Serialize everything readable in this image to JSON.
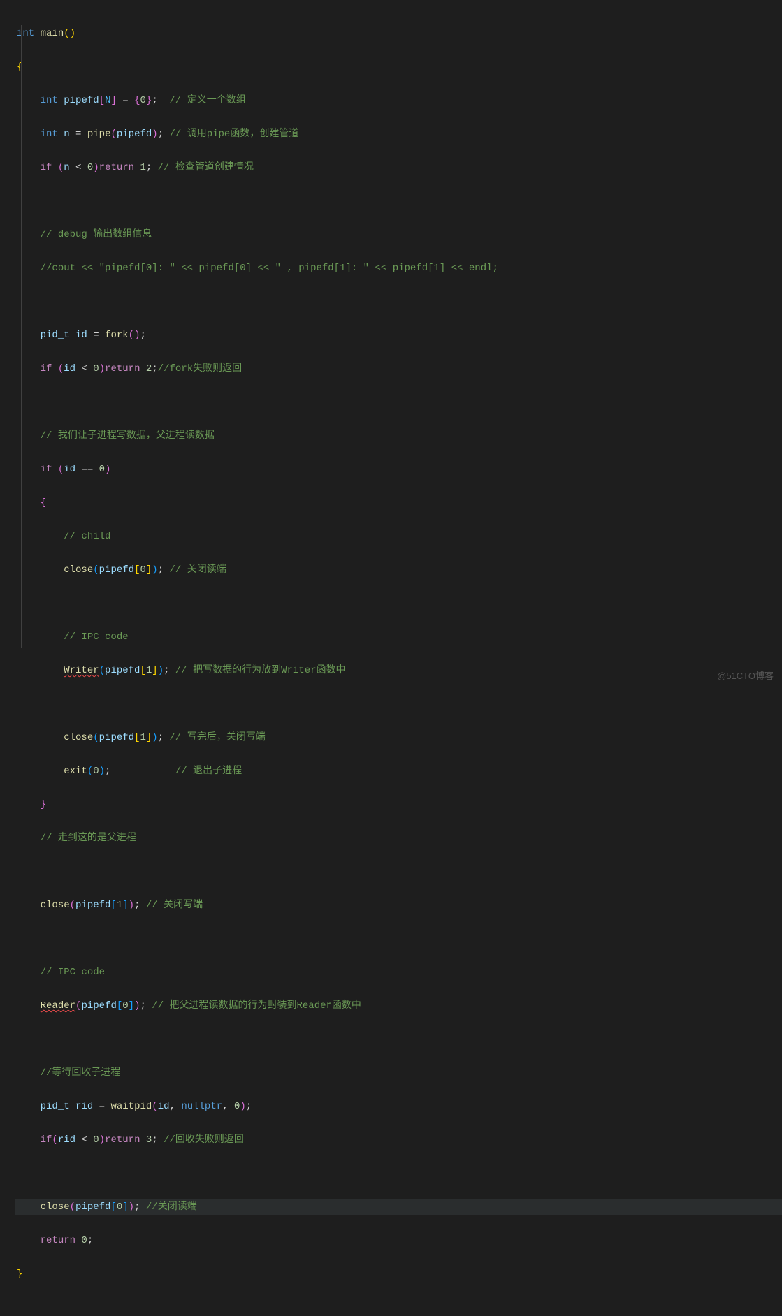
{
  "watermark": "@51CTO博客",
  "code": {
    "l1": {
      "t_int": "int",
      "t_main": "main",
      "t_op": "(",
      "t_cp": ")"
    },
    "l2": {
      "brace": "{"
    },
    "l3": {
      "int": "int",
      "var": "pipefd",
      "ob": "[",
      "N": "N",
      "cb": "]",
      "eq": " = ",
      "lb": "{",
      "zero": "0",
      "rb": "}",
      "semi": ";",
      "cmt": "  // 定义一个数组"
    },
    "l4": {
      "int": "int",
      "var": "n",
      "eq": " = ",
      "fn": "pipe",
      "op": "(",
      "arg": "pipefd",
      "cp": ")",
      "semi": ";",
      "cmt": " // 调用pipe函数，创建管道"
    },
    "l5": {
      "if": "if",
      "op": " (",
      "var": "n",
      "lt": " < ",
      "zero": "0",
      "cp": ")",
      "ret": "return",
      "one": " 1",
      "semi": ";",
      "cmt": " // 检查管道创建情况"
    },
    "l6": {},
    "l7": {
      "cmt": "// debug 输出数组信息"
    },
    "l8": {
      "cmt": "//cout << \"pipefd[0]: \" << pipefd[0] << \" , pipefd[1]: \" << pipefd[1] << endl;"
    },
    "l9": {},
    "l10": {
      "type": "pid_t",
      "var": "id",
      "eq": " = ",
      "fn": "fork",
      "op": "(",
      "cp": ")",
      "semi": ";"
    },
    "l11": {
      "if": "if",
      "op": " (",
      "var": "id",
      "lt": " < ",
      "zero": "0",
      "cp": ")",
      "ret": "return",
      "two": " 2",
      "semi": ";",
      "cmt": "//fork失败则返回"
    },
    "l12": {},
    "l13": {
      "cmt": "// 我们让子进程写数据，父进程读数据"
    },
    "l14": {
      "if": "if",
      "op": " (",
      "var": "id",
      "eq": " == ",
      "zero": "0",
      "cp": ")"
    },
    "l15": {
      "brace": "{"
    },
    "l16": {
      "cmt": "// child"
    },
    "l17": {
      "fn": "close",
      "op": "(",
      "var": "pipefd",
      "ob": "[",
      "idx": "0",
      "cb": "]",
      "cp": ")",
      "semi": ";",
      "cmt": " // 关闭读端"
    },
    "l18": {},
    "l19": {
      "cmt": "// IPC code"
    },
    "l20": {
      "fn": "Writer",
      "op": "(",
      "var": "pipefd",
      "ob": "[",
      "idx": "1",
      "cb": "]",
      "cp": ")",
      "semi": ";",
      "cmt": " // 把写数据的行为放到Writer函数中"
    },
    "l21": {},
    "l22": {
      "fn": "close",
      "op": "(",
      "var": "pipefd",
      "ob": "[",
      "idx": "1",
      "cb": "]",
      "cp": ")",
      "semi": ";",
      "cmt": " // 写完后，关闭写端"
    },
    "l23": {
      "fn": "exit",
      "op": "(",
      "idx": "0",
      "cp": ")",
      "semi": ";",
      "cmt": "           // 退出子进程"
    },
    "l24": {
      "brace": "}"
    },
    "l25": {
      "cmt": "// 走到这的是父进程"
    },
    "l26": {},
    "l27": {
      "fn": "close",
      "op": "(",
      "var": "pipefd",
      "ob": "[",
      "idx": "1",
      "cb": "]",
      "cp": ")",
      "semi": ";",
      "cmt": " // 关闭写端"
    },
    "l28": {},
    "l29": {
      "cmt": "// IPC code"
    },
    "l30": {
      "fn": "Reader",
      "op": "(",
      "var": "pipefd",
      "ob": "[",
      "idx": "0",
      "cb": "]",
      "cp": ")",
      "semi": ";",
      "cmt": " // 把父进程读数据的行为封装到Reader函数中"
    },
    "l31": {},
    "l32": {
      "cmt": "//等待回收子进程"
    },
    "l33": {
      "type": "pid_t",
      "var": "rid",
      "eq": " = ",
      "fn": "waitpid",
      "op": "(",
      "a1": "id",
      "c1": ", ",
      "a2": "nullptr",
      "c2": ", ",
      "a3": "0",
      "cp": ")",
      "semi": ";"
    },
    "l34": {
      "if": "if",
      "op": "(",
      "var": "rid",
      "lt": " < ",
      "zero": "0",
      "cp": ")",
      "ret": "return",
      "three": " 3",
      "semi": ";",
      "cmt": " //回收失败则返回"
    },
    "l35": {},
    "l36": {
      "fn": "close",
      "op": "(",
      "var": "pipefd",
      "ob": "[",
      "idx": "0",
      "cb": "]",
      "cp": ")",
      "semi": ";",
      "cmt": " //关闭读端"
    },
    "l37": {
      "ret": "return",
      "zero": " 0",
      "semi": ";"
    },
    "l38": {
      "brace": "}"
    }
  }
}
